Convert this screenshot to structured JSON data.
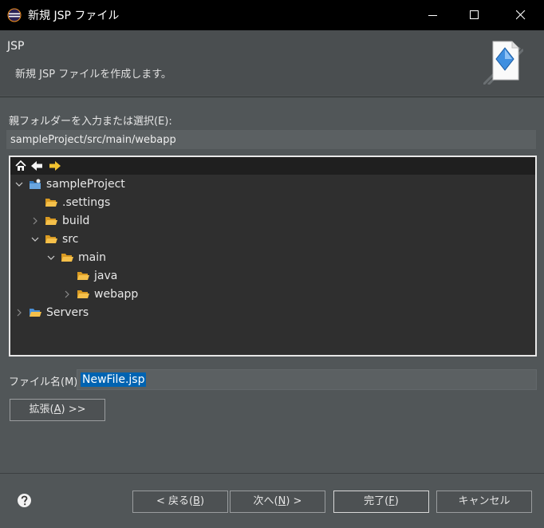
{
  "window": {
    "title": "新規 JSP ファイル",
    "icon": "eclipse-icon"
  },
  "banner": {
    "title": "JSP",
    "message": "新規 JSP ファイルを作成します。",
    "image": "jsp-wizard-icon"
  },
  "parent_folder": {
    "label": "親フォルダーを入力または選択(E):",
    "value": "sampleProject/src/main/webapp"
  },
  "tree": {
    "toolbar": [
      "home-icon",
      "back-arrow-icon",
      "forward-arrow-icon"
    ],
    "items": [
      {
        "label": "sampleProject",
        "icon": "project-icon",
        "twisty": "expanded"
      },
      {
        "label": ".settings",
        "icon": "folder-icon",
        "twisty": "none"
      },
      {
        "label": "build",
        "icon": "folder-icon",
        "twisty": "collapsed"
      },
      {
        "label": "src",
        "icon": "folder-icon",
        "twisty": "expanded"
      },
      {
        "label": "main",
        "icon": "folder-icon",
        "twisty": "expanded"
      },
      {
        "label": "java",
        "icon": "folder-icon",
        "twisty": "none"
      },
      {
        "label": "webapp",
        "icon": "folder-icon",
        "twisty": "collapsed"
      },
      {
        "label": "Servers",
        "icon": "folder-icon",
        "twisty": "collapsed"
      }
    ]
  },
  "file_name": {
    "label": "ファイル名(M):",
    "value": "NewFile.jsp"
  },
  "buttons": {
    "advanced_pre": "拡張(",
    "advanced_key": "A",
    "advanced_post": ") >>",
    "back_pre": "< 戻る(",
    "back_key": "B",
    "back_post": ")",
    "next_pre": "次へ(",
    "next_key": "N",
    "next_post": ") >",
    "finish_pre": "完了(",
    "finish_key": "F",
    "finish_post": ")",
    "cancel": "キャンセル"
  },
  "colors": {
    "accent_selection": "#0063b1",
    "folder": "#f2b43c",
    "background": "#515658"
  }
}
